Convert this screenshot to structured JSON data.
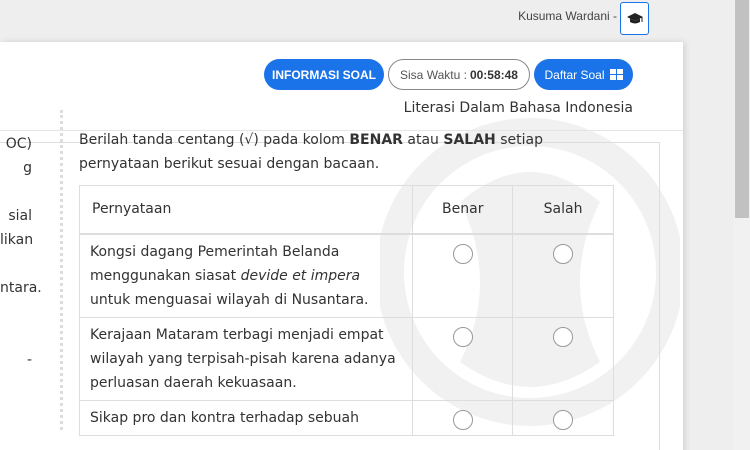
{
  "header": {
    "user_name": "Kusuma Wardani -",
    "cap_icon": "graduation-cap-icon"
  },
  "toolbar": {
    "info_label": "INFORMASI SOAL",
    "timer_label": "Sisa Waktu :",
    "timer_value": "00:58:48",
    "list_label": "Daftar Soal",
    "list_icon": "grid-icon",
    "accent_color": "#1a73e8"
  },
  "subject": "Literasi Dalam Bahasa Indonesia",
  "left_fragments": [
    "OC)",
    "g",
    "",
    "sial",
    "likan",
    "",
    "ntara.",
    "",
    "",
    "-"
  ],
  "instruction": {
    "before": "Berilah tanda centang (√) pada kolom ",
    "bold1": "BENAR",
    "mid": " atau ",
    "bold2": "SALAH",
    "after": " setiap pernyataan berikut sesuai dengan bacaan."
  },
  "table": {
    "headers": [
      "Pernyataan",
      "Benar",
      "Salah"
    ],
    "rows": [
      {
        "pre": "Kongsi dagang Pemerintah Belanda menggunakan siasat ",
        "em": "devide et impera",
        "post": " untuk menguasai wilayah di Nusantara."
      },
      {
        "pre": "Kerajaan Mataram terbagi menjadi empat wilayah yang terpisah-pisah karena adanya perluasan daerah kekuasaan.",
        "em": "",
        "post": ""
      },
      {
        "pre": "Sikap pro dan kontra terhadap sebuah",
        "em": "",
        "post": ""
      }
    ]
  }
}
